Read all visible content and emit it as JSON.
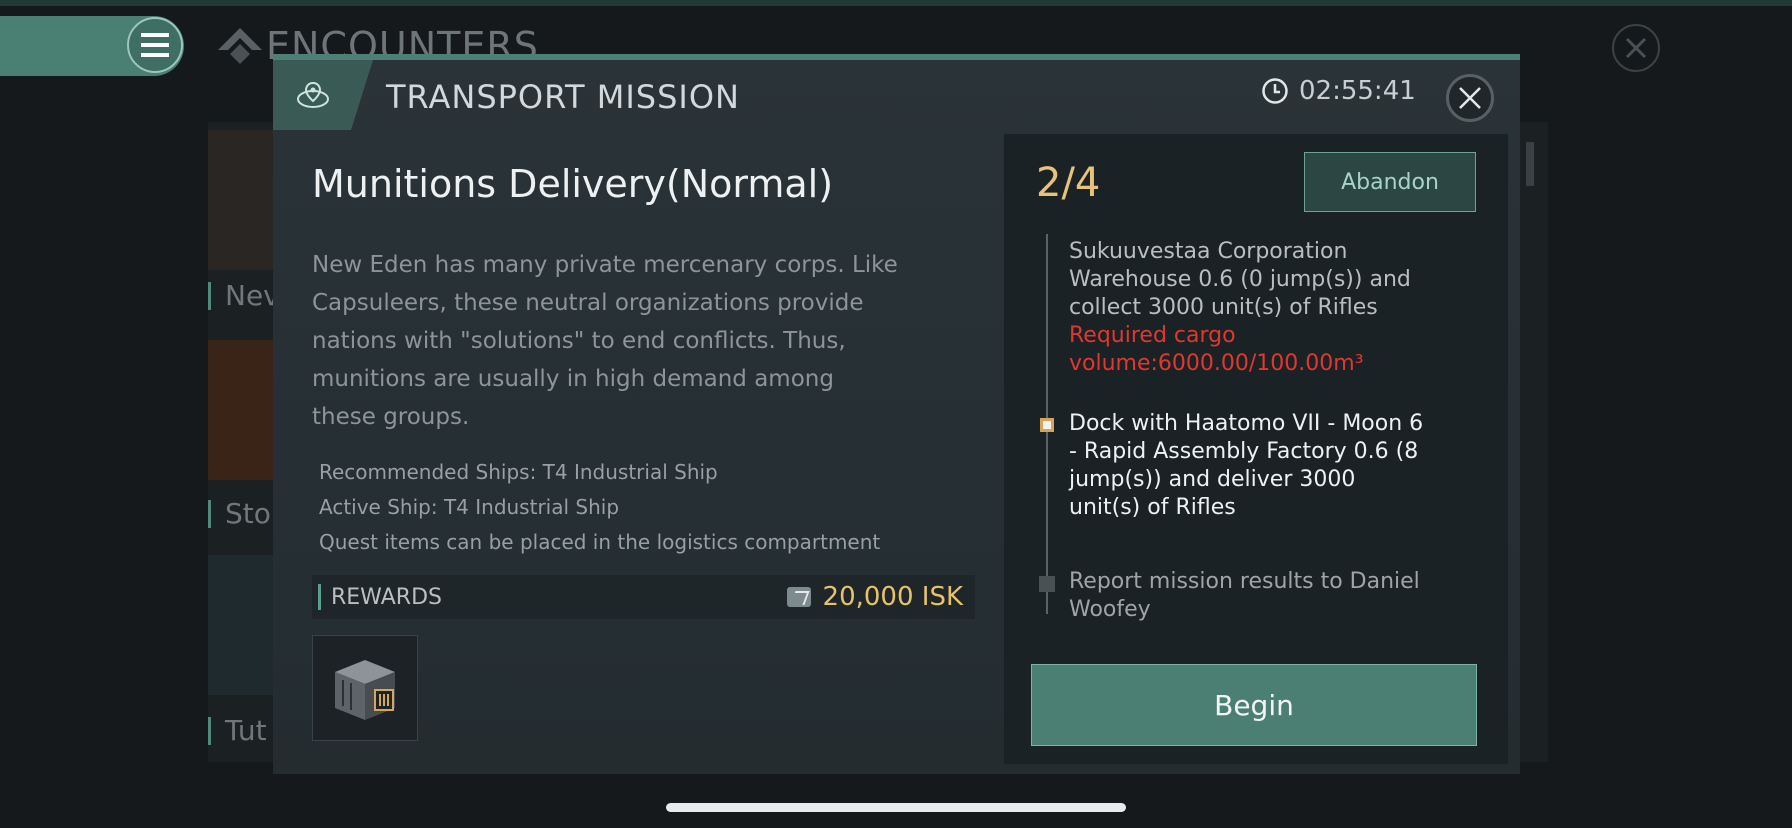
{
  "background": {
    "title": "ENCOUNTERS",
    "list_labels": [
      "Nev",
      "Sto",
      "Tut"
    ]
  },
  "dialog": {
    "title": "TRANSPORT MISSION",
    "timer": "02:55:41",
    "mission_name": "Munitions Delivery(Normal)",
    "description": "New Eden has many private mercenary corps. Like Capsuleers, these neutral organizations provide nations with \"solutions\" to end conflicts. Thus, munitions are usually in high demand among these groups.",
    "info": {
      "recommended_ships": "Recommended Ships: T4 Industrial Ship",
      "active_ship": "Active Ship: T4 Industrial Ship",
      "quest_items": "Quest items can be placed in the logistics compartment"
    },
    "rewards": {
      "label": "REWARDS",
      "amount": "20,000 ISK"
    }
  },
  "steps_panel": {
    "progress": "2/4",
    "abandon_label": "Abandon",
    "steps": [
      {
        "text": "Sukuuvestaa Corporation Warehouse 0.6 (0 jump(s)) and collect 3000 unit(s) of Rifles",
        "warning": "Required cargo volume:6000.00/100.00m³"
      },
      {
        "text": "Dock with Haatomo VII - Moon 6 - Rapid Assembly Factory 0.6 (8 jump(s)) and deliver 3000 unit(s) of Rifles"
      },
      {
        "text": "Report mission results to Daniel Woofey"
      }
    ],
    "begin_label": "Begin"
  },
  "colors": {
    "accent": "#4c7f74",
    "gold": "#e6c27b",
    "warning": "#e0372e"
  },
  "icons": [
    "menu-icon",
    "encounters-logo-icon",
    "close-icon",
    "mission-type-icon",
    "clock-icon",
    "isk-icon",
    "cargo-crate-icon"
  ]
}
